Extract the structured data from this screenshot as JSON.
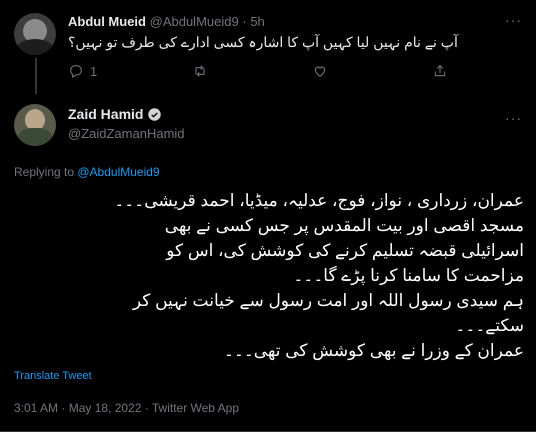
{
  "reply": {
    "name": "Abdul Mueid",
    "handle": "@AbdulMueid9",
    "time": "5h",
    "dot": "·",
    "text": "آپ نے نام نہیں لیا کہیں آپ کا اشارہ کسی ادارے کی طرف تو نہیں؟",
    "reply_count": "1",
    "more": "···"
  },
  "tweet": {
    "name": "Zaid Hamid",
    "handle": "@ZaidZamanHamid",
    "replying_prefix": "Replying to ",
    "replying_to": "@AbdulMueid9",
    "text": "عمران، زرداری ، نواز، فوج، عدلیہ، میڈیا، احمد قریشی۔۔۔\nمسجد اقصی اور بیت المقدس پر جس کسی نے بھی\nاسرائیلی قبضہ تسلیم کرنے کی کوشش کی، اس کو\nمزاحمت کا سامنا کرنا پڑے گا۔۔۔\nہم سیدی رسول اللہ اور امت رسول سے خیانت نہیں کر\nسکتے۔۔۔\nعمران کے وزرا نے بھی کوشش کی تھی۔۔۔",
    "translate_label": "Translate Tweet",
    "meta": "3:01 AM · May 18, 2022 · Twitter Web App",
    "more": "···"
  },
  "colors": {
    "accent": "#1d9bf0",
    "background": "#000000",
    "muted": "#71767b"
  }
}
